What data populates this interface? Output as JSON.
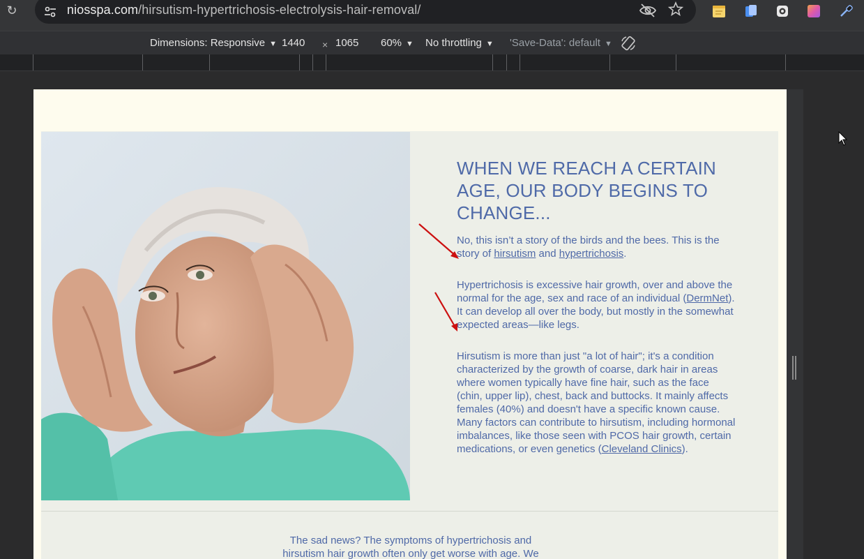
{
  "browser": {
    "url_host": "niosspa.com",
    "url_path": "/hirsutism-hypertrichosis-electrolysis-hair-removal/"
  },
  "devtools": {
    "dimensions_label": "Dimensions: Responsive",
    "width": "1440",
    "times": "×",
    "height": "1065",
    "zoom": "60%",
    "throttling": "No throttling",
    "save_data": "'Save-Data': default"
  },
  "page": {
    "headline": "WHEN WE REACH A CERTAIN AGE, OUR BODY BEGINS TO CHANGE...",
    "p1": {
      "before": "No, this isn’t a story of the birds and the bees. This is the story of ",
      "link1": "hirsutism",
      "mid": " and ",
      "link2": "hypertrichosis",
      "after": "."
    },
    "p2": {
      "before": "Hypertrichosis is excessive hair growth, over and above the normal for the age, sex and race of an individual (",
      "link": "DermNet",
      "after": "). It can develop all over the body, but mostly in the somewhat expected areas—like legs."
    },
    "p3": {
      "before": "Hirsutism is more than just \"a lot of hair\"; it's a condition characterized by the growth of coarse, dark hair in areas where women typically have fine hair, such as the face (chin, upper lip), chest, back and buttocks. It mainly affects females (40%) and doesn't have a specific known cause. Many factors can contribute to hirsutism, including hormonal imbalances, like those seen with PCOS hair growth, certain medications, or even genetics (",
      "link": "Cleveland Clinics",
      "after": ")."
    },
    "bottom_text": "The sad news? The symptoms of hypertrichosis and hirsutism hair growth often only get worse with age. We"
  },
  "colors": {
    "text_blue": "#4f69a7",
    "panel_bg": "#edefe8",
    "page_bg": "#fefcee",
    "annotation_red": "#cc1010"
  }
}
